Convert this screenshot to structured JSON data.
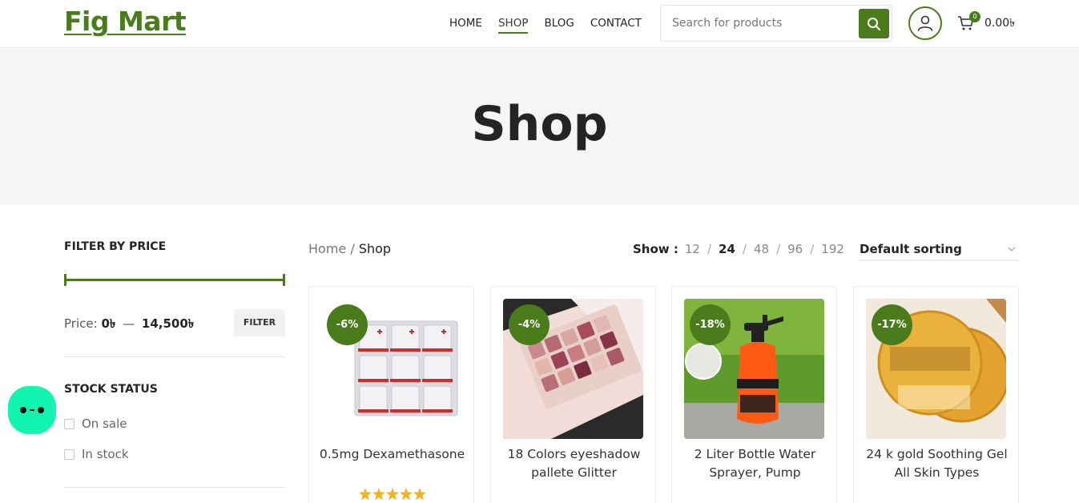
{
  "header": {
    "logo": "Fig Mart",
    "nav": [
      {
        "label": "HOME",
        "active": false
      },
      {
        "label": "SHOP",
        "active": true
      },
      {
        "label": "BLOG",
        "active": false
      },
      {
        "label": "CONTACT",
        "active": false
      }
    ],
    "search_placeholder": "Search for products",
    "cart_count": "0",
    "cart_total": "0.00৳"
  },
  "hero": {
    "title": "Shop"
  },
  "sidebar": {
    "filter_price_title": "FILTER BY PRICE",
    "price_label": "Price:",
    "price_min": "0৳",
    "price_sep": "—",
    "price_max": "14,500৳",
    "filter_button": "FILTER",
    "stock_title": "STOCK STATUS",
    "stock_options": [
      "On sale",
      "In stock"
    ]
  },
  "toolbar": {
    "breadcrumb_home": "Home",
    "breadcrumb_sep": " / ",
    "breadcrumb_current": "Shop",
    "show_label": "Show :",
    "show_options": [
      "12",
      "24",
      "48",
      "96",
      "192"
    ],
    "show_selected": "24",
    "sorting": "Default sorting"
  },
  "products": [
    {
      "name": "0.5mg Dexamethasone",
      "discount": "-6%",
      "rating_stars": 5
    },
    {
      "name": "18 Colors eyeshadow pallete Glitter",
      "discount": "-4%"
    },
    {
      "name": "2 Liter Bottle Water Sprayer, Pump",
      "discount": "-18%"
    },
    {
      "name": "24 k gold Soothing Gel All Skin Types",
      "discount": "-17%"
    }
  ],
  "colors": {
    "brand": "#4a7c1c",
    "chat": "#11f5b0",
    "star": "#f0b41c"
  }
}
